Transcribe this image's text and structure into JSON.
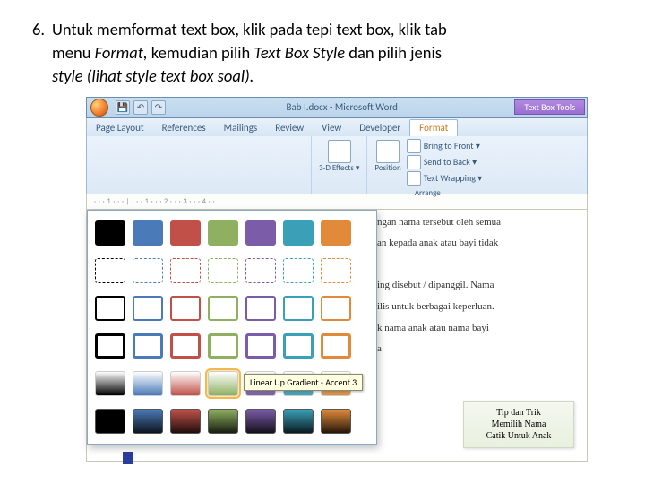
{
  "instruction": {
    "number": "6.",
    "line1": "Untuk memformat text box, klik pada tepi text box, klik tab",
    "line2_a": "menu ",
    "line2_b": "Format,",
    "line2_c": " kemudian pilih ",
    "line2_d": "Text Box Style",
    "line2_e": " dan pilih jenis",
    "line3": "style (lihat style text box soal)."
  },
  "titlebar": {
    "title": "Bab I.docx - Microsoft Word",
    "context": "Text Box Tools"
  },
  "tabs": [
    "Page Layout",
    "References",
    "Mailings",
    "Review",
    "View",
    "Developer",
    "Format"
  ],
  "active_tab_index": 6,
  "ribbon": {
    "effects": "3-D Effects ▾",
    "position": "Position",
    "bring": "Bring to Front ▾",
    "send": "Send to Back ▾",
    "wrap": "Text Wrapping ▾",
    "arrange": "Arrange"
  },
  "ruler_text": "· · · 1 · · · | · · · 1 · · · 2 · · · 3 · · · 4 · ·",
  "gallery": {
    "colors": [
      "#000000",
      "#4a7ab8",
      "#c05048",
      "#8eb060",
      "#7a5ca8",
      "#3aa0b8",
      "#e08a3a"
    ],
    "tooltip": "Linear Up Gradient - Accent 3",
    "selected": {
      "row": 4,
      "col": 3
    }
  },
  "doc_lines": [
    "ngan nama tersebut oleh semua",
    "an kepada anak atau bayi tidak",
    "",
    "ing disebut / dipanggil. Nama",
    "ilis untuk berbagai keperluan.",
    "k nama anak atau nama bayi",
    "a"
  ],
  "callout": {
    "l1": "Tip dan Trik",
    "l2": "Memilih Nama",
    "l3": "Catik Untuk Anak"
  }
}
